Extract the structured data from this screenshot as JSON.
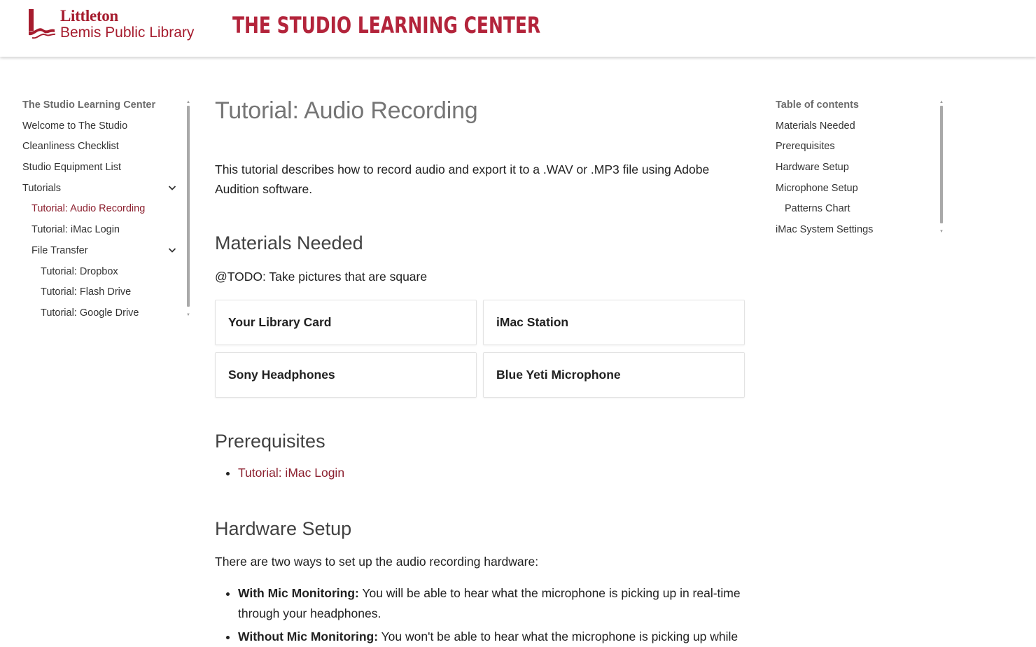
{
  "header": {
    "logo_line1": "Littleton",
    "logo_line2": "Bemis Public Library",
    "site_title": "THE STUDIO LEARNING CENTER",
    "brand_color": "#a61c2e"
  },
  "left_nav": {
    "heading": "The Studio Learning Center",
    "items": [
      {
        "label": "Welcome to The Studio"
      },
      {
        "label": "Cleanliness Checklist"
      },
      {
        "label": "Studio Equipment List"
      },
      {
        "label": "Tutorials",
        "expanded": true
      },
      {
        "label": "Tutorial: Audio Recording",
        "active": true
      },
      {
        "label": "Tutorial: iMac Login"
      },
      {
        "label": "File Transfer",
        "expanded": true
      },
      {
        "label": "Tutorial: Dropbox"
      },
      {
        "label": "Tutorial: Flash Drive"
      },
      {
        "label": "Tutorial: Google Drive"
      }
    ]
  },
  "main": {
    "title": "Tutorial: Audio Recording",
    "intro": "This tutorial describes how to record audio and export it to a .WAV or .MP3 file using Adobe Audition software.",
    "materials": {
      "heading": "Materials Needed",
      "note": "@TODO: Take pictures that are square",
      "cards": [
        "Your Library Card",
        "iMac Station",
        "Sony Headphones",
        "Blue Yeti Microphone"
      ]
    },
    "prerequisites": {
      "heading": "Prerequisites",
      "links": [
        "Tutorial: iMac Login"
      ]
    },
    "hardware": {
      "heading": "Hardware Setup",
      "intro": "There are two ways to set up the audio recording hardware:",
      "items": [
        {
          "term": "With Mic Monitoring:",
          "text": " You will be able to hear what the microphone is picking up in real-time through your headphones."
        },
        {
          "term": "Without Mic Monitoring:",
          "text": " You won't be able to hear what the microphone is picking up while"
        }
      ]
    }
  },
  "toc": {
    "heading": "Table of contents",
    "items": [
      {
        "label": "Materials Needed"
      },
      {
        "label": "Prerequisites"
      },
      {
        "label": "Hardware Setup"
      },
      {
        "label": "Microphone Setup"
      },
      {
        "label": "Patterns Chart",
        "indent": true
      },
      {
        "label": "iMac System Settings"
      }
    ]
  }
}
